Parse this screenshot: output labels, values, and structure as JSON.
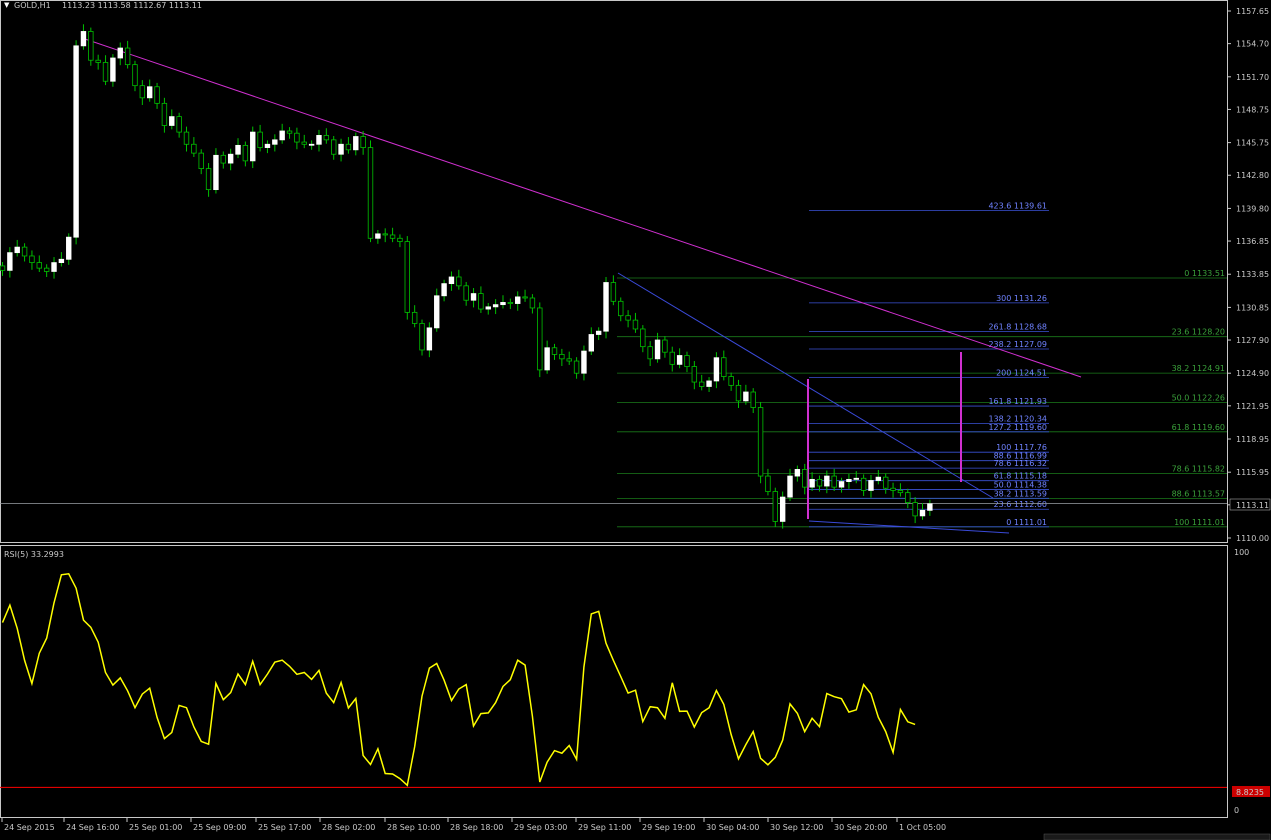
{
  "window": {
    "symbol_header": "GOLD,H1",
    "ohlc_text": "1113.23 1113.58 1112.67 1113.11",
    "current_price": "1113.11",
    "rsi_header": "RSI(5) 33.2993",
    "rsi_current_level": "8.8235"
  },
  "colors": {
    "background": "#000000",
    "frame": "#c8c8c8",
    "bull_candle": "#ffffff",
    "candle_wick": "#00c000",
    "trendline": "#d030d0",
    "channel": "#3a4ad8",
    "fib_green": "#1a7a1a",
    "fib_blue": "#3b52d6",
    "rsi_line": "#ffff00",
    "rsi_level": "#ff0000"
  },
  "price_axis": {
    "ticks": [
      "1157.65",
      "1154.70",
      "1151.70",
      "1148.75",
      "1145.75",
      "1142.80",
      "1139.80",
      "1136.85",
      "1133.85",
      "1130.85",
      "1127.90",
      "1124.90",
      "1121.95",
      "1118.95",
      "1115.95",
      "1113.00",
      "1110.00"
    ]
  },
  "rsi_axis": {
    "ticks": [
      "100",
      "0"
    ]
  },
  "time_axis": {
    "labels": [
      "24 Sep 2015",
      "24 Sep 16:00",
      "25 Sep 01:00",
      "25 Sep 09:00",
      "25 Sep 17:00",
      "28 Sep 02:00",
      "28 Sep 10:00",
      "28 Sep 18:00",
      "29 Sep 03:00",
      "29 Sep 11:00",
      "29 Sep 19:00",
      "30 Sep 04:00",
      "30 Sep 12:00",
      "30 Sep 20:00",
      "1 Oct 05:00"
    ]
  },
  "fib_labels": {
    "green": [
      "0 1133.51",
      "23.6 1128.20",
      "38.2 1124.91",
      "50.0 1122.26",
      "61.8 1119.60",
      "78.6 1115.82",
      "88.6 1113.57",
      "100 1111.01"
    ],
    "blue": [
      "423.6 1139.61",
      "300 1131.26",
      "261.8 1128.68",
      "238.2 1127.09",
      "200 1124.51",
      "161.8 1121.93",
      "138.2 1120.34",
      "127.2 1119.60",
      "100 1117.76",
      "88.6 1116.99",
      "78.6 1116.32",
      "61.8 1115.18",
      "50.0 1114.38",
      "38.2 1113.59",
      "23.6 1112.60",
      "0 1111.01"
    ]
  },
  "chart_data": [
    {
      "type": "candlestick",
      "title": "GOLD,H1",
      "ylim": [
        1110.0,
        1157.65
      ],
      "ohlc_last": [
        1113.23,
        1113.58,
        1112.67,
        1113.11
      ],
      "close": [
        1134.2,
        1135.8,
        1136.3,
        1135.5,
        1134.9,
        1134.4,
        1134.1,
        1134.9,
        1135.2,
        1137.2,
        1154.5,
        1155.8,
        1153.2,
        1153.0,
        1151.3,
        1153.4,
        1154.3,
        1152.8,
        1150.9,
        1149.8,
        1150.8,
        1149.3,
        1147.3,
        1148.1,
        1146.7,
        1145.6,
        1144.8,
        1143.4,
        1141.5,
        1144.6,
        1143.9,
        1144.7,
        1145.5,
        1144.1,
        1146.7,
        1145.3,
        1145.6,
        1146.0,
        1146.8,
        1146.6,
        1145.8,
        1145.6,
        1145.6,
        1146.4,
        1146.0,
        1144.7,
        1145.6,
        1145.1,
        1146.3,
        1145.3,
        1137.1,
        1137.5,
        1137.4,
        1137.1,
        1136.8,
        1130.4,
        1129.4,
        1127.0,
        1129.0,
        1131.9,
        1133.0,
        1133.6,
        1132.8,
        1131.5,
        1132.1,
        1130.7,
        1130.9,
        1131.1,
        1131.3,
        1131.2,
        1131.8,
        1131.7,
        1130.8,
        1125.2,
        1127.2,
        1126.6,
        1126.2,
        1126.0,
        1124.9,
        1126.9,
        1128.4,
        1128.7,
        1133.1,
        1131.4,
        1130.1,
        1129.7,
        1128.9,
        1127.3,
        1126.2,
        1127.9,
        1126.8,
        1125.7,
        1126.5,
        1125.5,
        1124.1,
        1123.7,
        1124.2,
        1126.3,
        1124.6,
        1123.8,
        1122.4,
        1123.2,
        1121.8,
        1115.6,
        1114.2,
        1111.5,
        1113.7,
        1115.6,
        1116.2,
        1114.6,
        1115.3,
        1114.7,
        1115.6,
        1114.6,
        1115.1,
        1115.3,
        1115.4,
        1114.3,
        1115.2,
        1115.5,
        1114.5,
        1114.3,
        1114.1,
        1113.2,
        1112.0,
        1112.5,
        1113.1
      ]
    },
    {
      "type": "line",
      "title": "RSI(5) 33.2993",
      "ylim": [
        0,
        100
      ],
      "levels": [
        8.8235
      ],
      "series": [
        {
          "name": "RSI(5)",
          "values": [
            72.9,
            79.7,
            70.7,
            58.2,
            49.2,
            61.0,
            66.9,
            80.6,
            91.5,
            91.9,
            86.3,
            73.9,
            71.1,
            65.3,
            53.5,
            48.6,
            51.4,
            46.4,
            39.8,
            45.1,
            47.4,
            36.0,
            27.8,
            30.2,
            40.7,
            39.8,
            32.3,
            26.7,
            25.6,
            49.3,
            42.9,
            45.7,
            52.9,
            48.8,
            57.9,
            48.8,
            52.9,
            57.5,
            58.3,
            55.9,
            52.8,
            53.5,
            50.8,
            54.3,
            45.5,
            41.8,
            49.6,
            39.7,
            43.4,
            21.2,
            17.7,
            23.8,
            14.2,
            14.0,
            12.2,
            9.6,
            24.7,
            44.3,
            55.2,
            57.0,
            50.5,
            42.6,
            47.1,
            48.8,
            32.7,
            37.5,
            37.8,
            41.8,
            48.1,
            50.7,
            58.3,
            56.4,
            36.5,
            10.9,
            18.6,
            23.1,
            22.1,
            25.1,
            19.7,
            55.6,
            76.3,
            77.3,
            64.9,
            58.2,
            52.0,
            45.5,
            46.6,
            34.4,
            40.2,
            39.8,
            35.7,
            49.5,
            38.4,
            38.5,
            32.3,
            37.9,
            39.8,
            46.5,
            41.1,
            29.4,
            19.9,
            25.5,
            30.5,
            20.1,
            17.6,
            20.5,
            27.2,
            41.3,
            37.6,
            30.5,
            35.7,
            32.4,
            45.3,
            44.1,
            43.3,
            38.1,
            39.0,
            48.8,
            45.2,
            36.1,
            30.5,
            22.4,
            39.1,
            34.3,
            33.3
          ]
        }
      ]
    }
  ]
}
